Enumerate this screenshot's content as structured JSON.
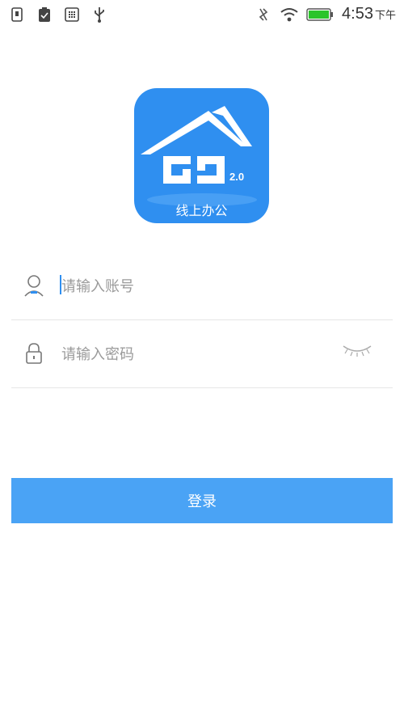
{
  "status_bar": {
    "time": "4:53",
    "time_suffix": "下午",
    "icons": [
      "sim-icon",
      "clipboard-icon",
      "grid-icon",
      "usb-icon",
      "vibrate-icon",
      "wifi-icon",
      "battery-icon"
    ]
  },
  "logo": {
    "caption": "线上办公",
    "version": "2.0"
  },
  "form": {
    "account_placeholder": "请输入账号",
    "password_placeholder": "请输入密码",
    "login_label": "登录"
  },
  "colors": {
    "brand": "#2f8ff0",
    "button": "#4aa3f5",
    "battery": "#2bc42b"
  }
}
